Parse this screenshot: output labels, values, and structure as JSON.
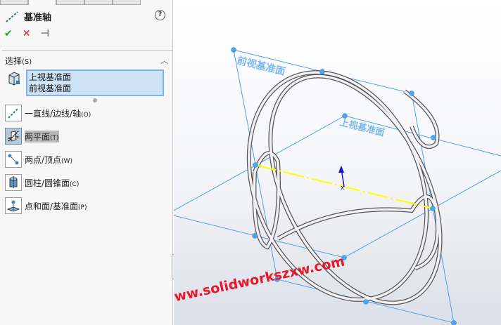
{
  "panel": {
    "title": "基准轴",
    "help": "?",
    "accept": "✔",
    "cancel": "✕",
    "pin": "⊣",
    "section": "选择",
    "section_key": "(S)",
    "selections": [
      "上视基准面",
      "前视基准面"
    ],
    "options": [
      {
        "label": "一直线/边线/轴",
        "key": "(O)",
        "icon": "line-axis-icon"
      },
      {
        "label": "两平面",
        "key": "(T)",
        "icon": "two-planes-icon",
        "selected": true
      },
      {
        "label": "两点/顶点",
        "key": "(W)",
        "icon": "two-points-icon"
      },
      {
        "label": "圆柱/圆锥面",
        "key": "(C)",
        "icon": "cylinder-icon"
      },
      {
        "label": "点和面/基准面",
        "key": "(P)",
        "icon": "point-plane-icon"
      }
    ]
  },
  "viewport": {
    "front_plane_label": "前视基准面",
    "top_plane_label": "上视基准面",
    "watermark": "www.solidworkszxw.com",
    "colors": {
      "plane": "#4a9ff0",
      "axis": "#ffff00",
      "watermark": "#e8182a",
      "accept": "#2ea02e",
      "cancel": "#d42020"
    }
  }
}
